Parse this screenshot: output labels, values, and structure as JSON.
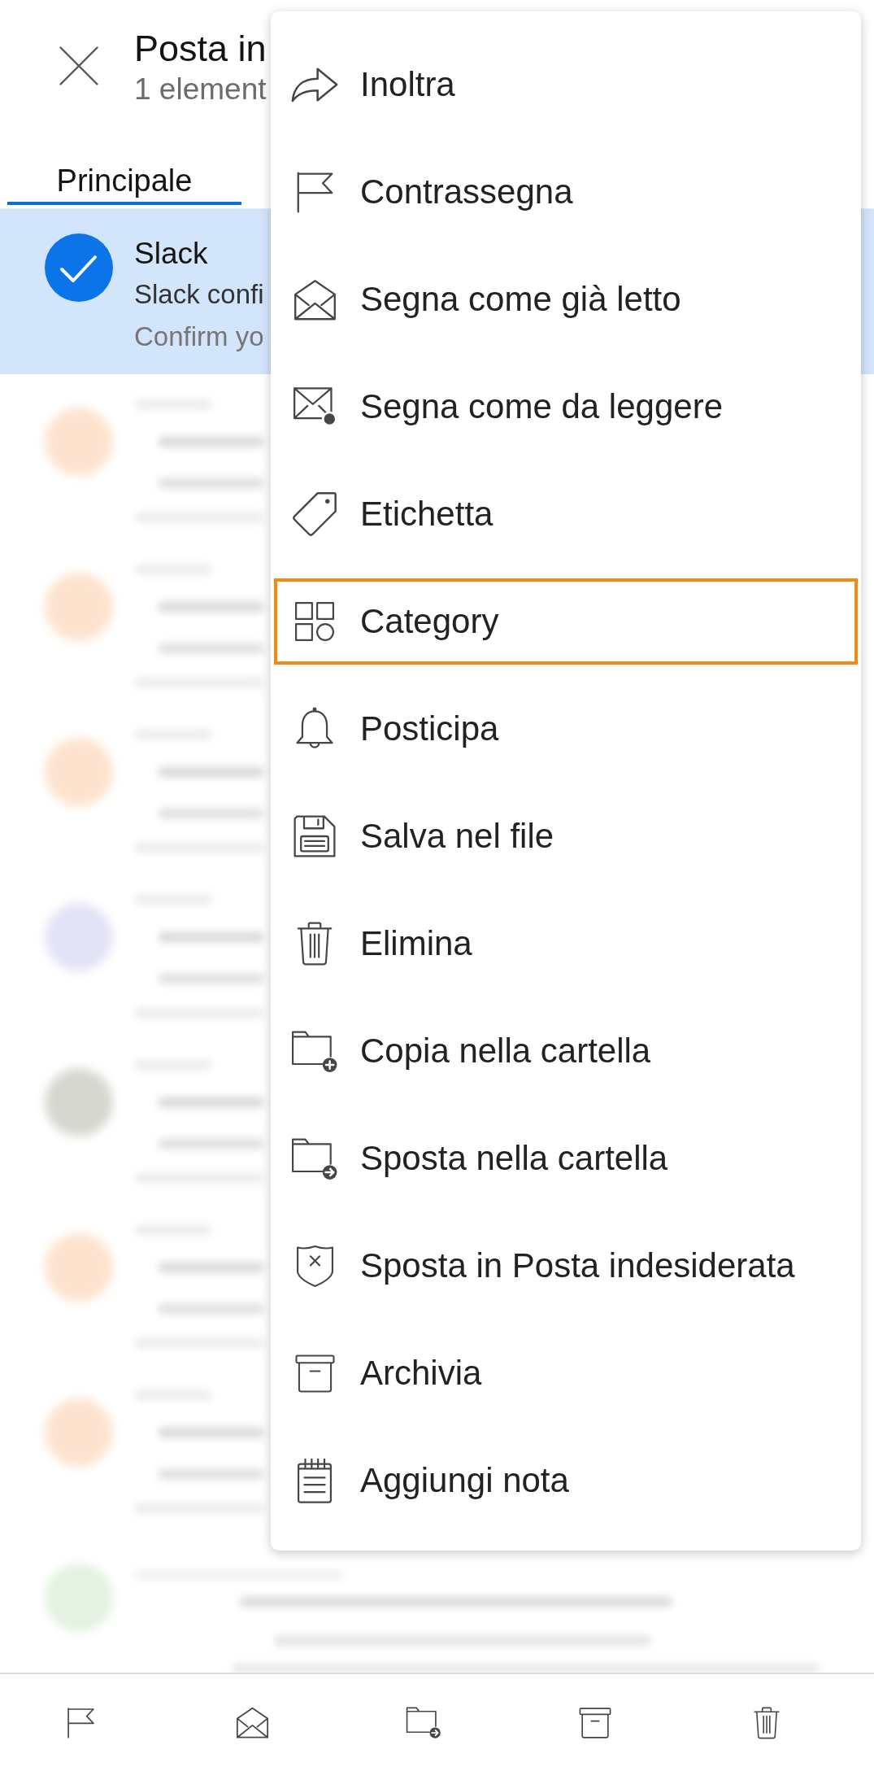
{
  "header": {
    "title": "Posta in",
    "subtitle": "1 element"
  },
  "tabs": [
    {
      "label": "Principale",
      "selected": true
    }
  ],
  "messages": [
    {
      "sender": "Slack",
      "subject": "Slack confi",
      "preview": "Confirm yo",
      "selected": true
    }
  ],
  "blurred_messages": [
    {
      "color": "#fde3cd"
    },
    {
      "color": "#fde3cd"
    },
    {
      "color": "#fde3cd"
    },
    {
      "color": "#e3e3f7"
    },
    {
      "color": "#d6d8cf"
    },
    {
      "color": "#fde3cd"
    },
    {
      "color": "#fde3cd"
    },
    {
      "color": "#e3f2e1"
    }
  ],
  "menu": {
    "items": [
      {
        "label": "Inoltra",
        "highlighted": false
      },
      {
        "label": "Contrassegna",
        "highlighted": false
      },
      {
        "label": "Segna come già letto",
        "highlighted": false
      },
      {
        "label": "Segna come da leggere",
        "highlighted": false
      },
      {
        "label": "Etichetta",
        "highlighted": false
      },
      {
        "label": "Category",
        "highlighted": true
      },
      {
        "label": "Posticipa",
        "highlighted": false
      },
      {
        "label": "Salva nel file",
        "highlighted": false
      },
      {
        "label": "Elimina",
        "highlighted": false
      },
      {
        "label": "Copia nella cartella",
        "highlighted": false
      },
      {
        "label": "Sposta nella cartella",
        "highlighted": false
      },
      {
        "label": "Sposta in Posta indesiderata",
        "highlighted": false
      },
      {
        "label": "Archivia",
        "highlighted": false
      },
      {
        "label": "Aggiungi nota",
        "highlighted": false
      }
    ]
  }
}
